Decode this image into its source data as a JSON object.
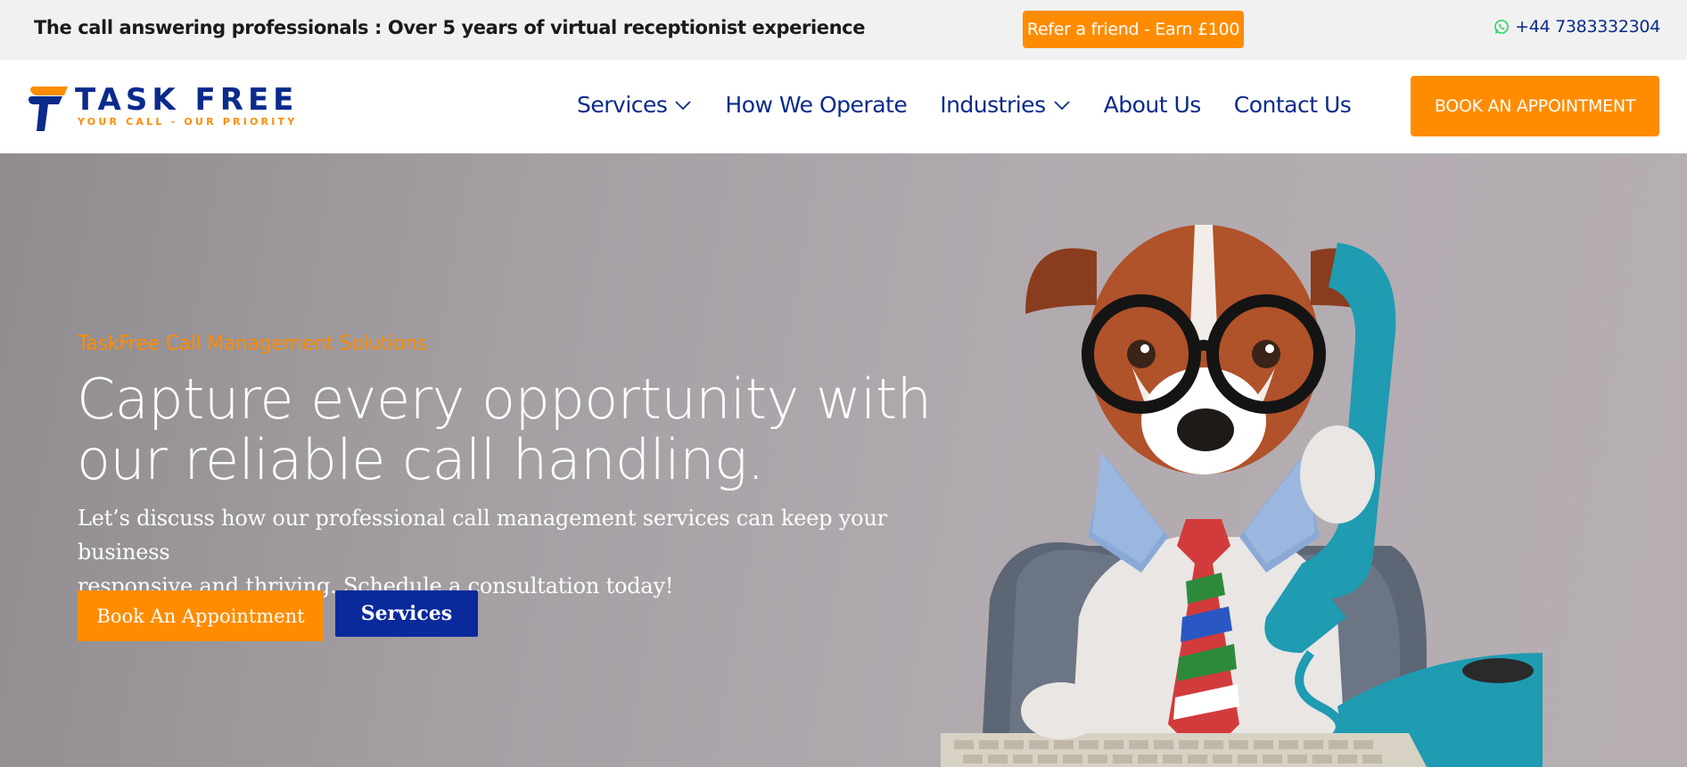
{
  "topbar": {
    "tagline": "The call answering professionals : Over 5 years of virtual receptionist experience",
    "refer_label": "Refer a friend - Earn £100",
    "phone": "+44 7383332304",
    "phone_icon": "whatsapp-icon"
  },
  "header": {
    "logo": {
      "name": "TASK FREE",
      "tagline": "YOUR CALL - OUR PRIORITY"
    },
    "nav": [
      {
        "label": "Services",
        "has_dropdown": true
      },
      {
        "label": "How We Operate",
        "has_dropdown": false
      },
      {
        "label": "Industries",
        "has_dropdown": true
      },
      {
        "label": "About Us",
        "has_dropdown": false
      },
      {
        "label": "Contact Us",
        "has_dropdown": false
      }
    ],
    "cta_label": "BOOK AN APPOINTMENT"
  },
  "hero": {
    "eyebrow": "TaskFree Call Management Solutions",
    "title_line1": "Capture every opportunity with",
    "title_line2": "our reliable call handling.",
    "body_line1": "Let’s discuss how our professional call management services can keep your business",
    "body_line2": "responsive and thriving. Schedule a consultation today!",
    "primary_button": "Book An Appointment",
    "secondary_button": "Services",
    "image_subject": "dog-with-glasses-on-phone"
  },
  "colors": {
    "brand_blue": "#0a2a8c",
    "accent_orange": "#ff8c00",
    "topbar_bg": "#f1f1f1",
    "whatsapp_green": "#25d366"
  }
}
